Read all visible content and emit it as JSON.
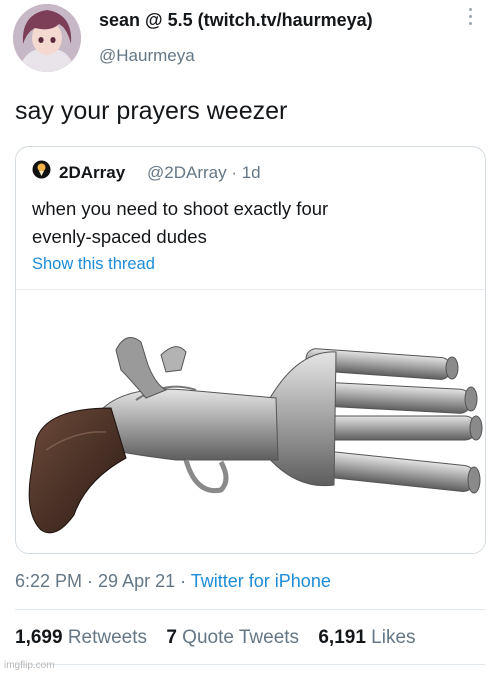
{
  "header": {
    "display_name": "sean @ 5.5 (twitch.tv/haurmeya)",
    "handle": "@Haurmeya"
  },
  "tweet": {
    "text": "say your prayers weezer"
  },
  "quoted_tweet": {
    "display_name": "2DArray",
    "handle": "@2DArray",
    "time": "1d",
    "text_line1": "when you need to shoot exactly four",
    "text_line2": "evenly-spaced dudes",
    "show_thread": "Show this thread",
    "image_subject": "four-barrel flintlock pistol"
  },
  "meta": {
    "time": "6:22 PM",
    "date": "29 Apr 21",
    "source": "Twitter for iPhone"
  },
  "stats": {
    "retweets_count": "1,699",
    "retweets_label": "Retweets",
    "quotes_count": "7",
    "quotes_label": "Quote Tweets",
    "likes_count": "6,191",
    "likes_label": "Likes"
  },
  "watermark": "imgflip.com",
  "colors": {
    "link": "#1d8cd8",
    "secondary_text": "#657786",
    "primary_text": "#14171a"
  }
}
